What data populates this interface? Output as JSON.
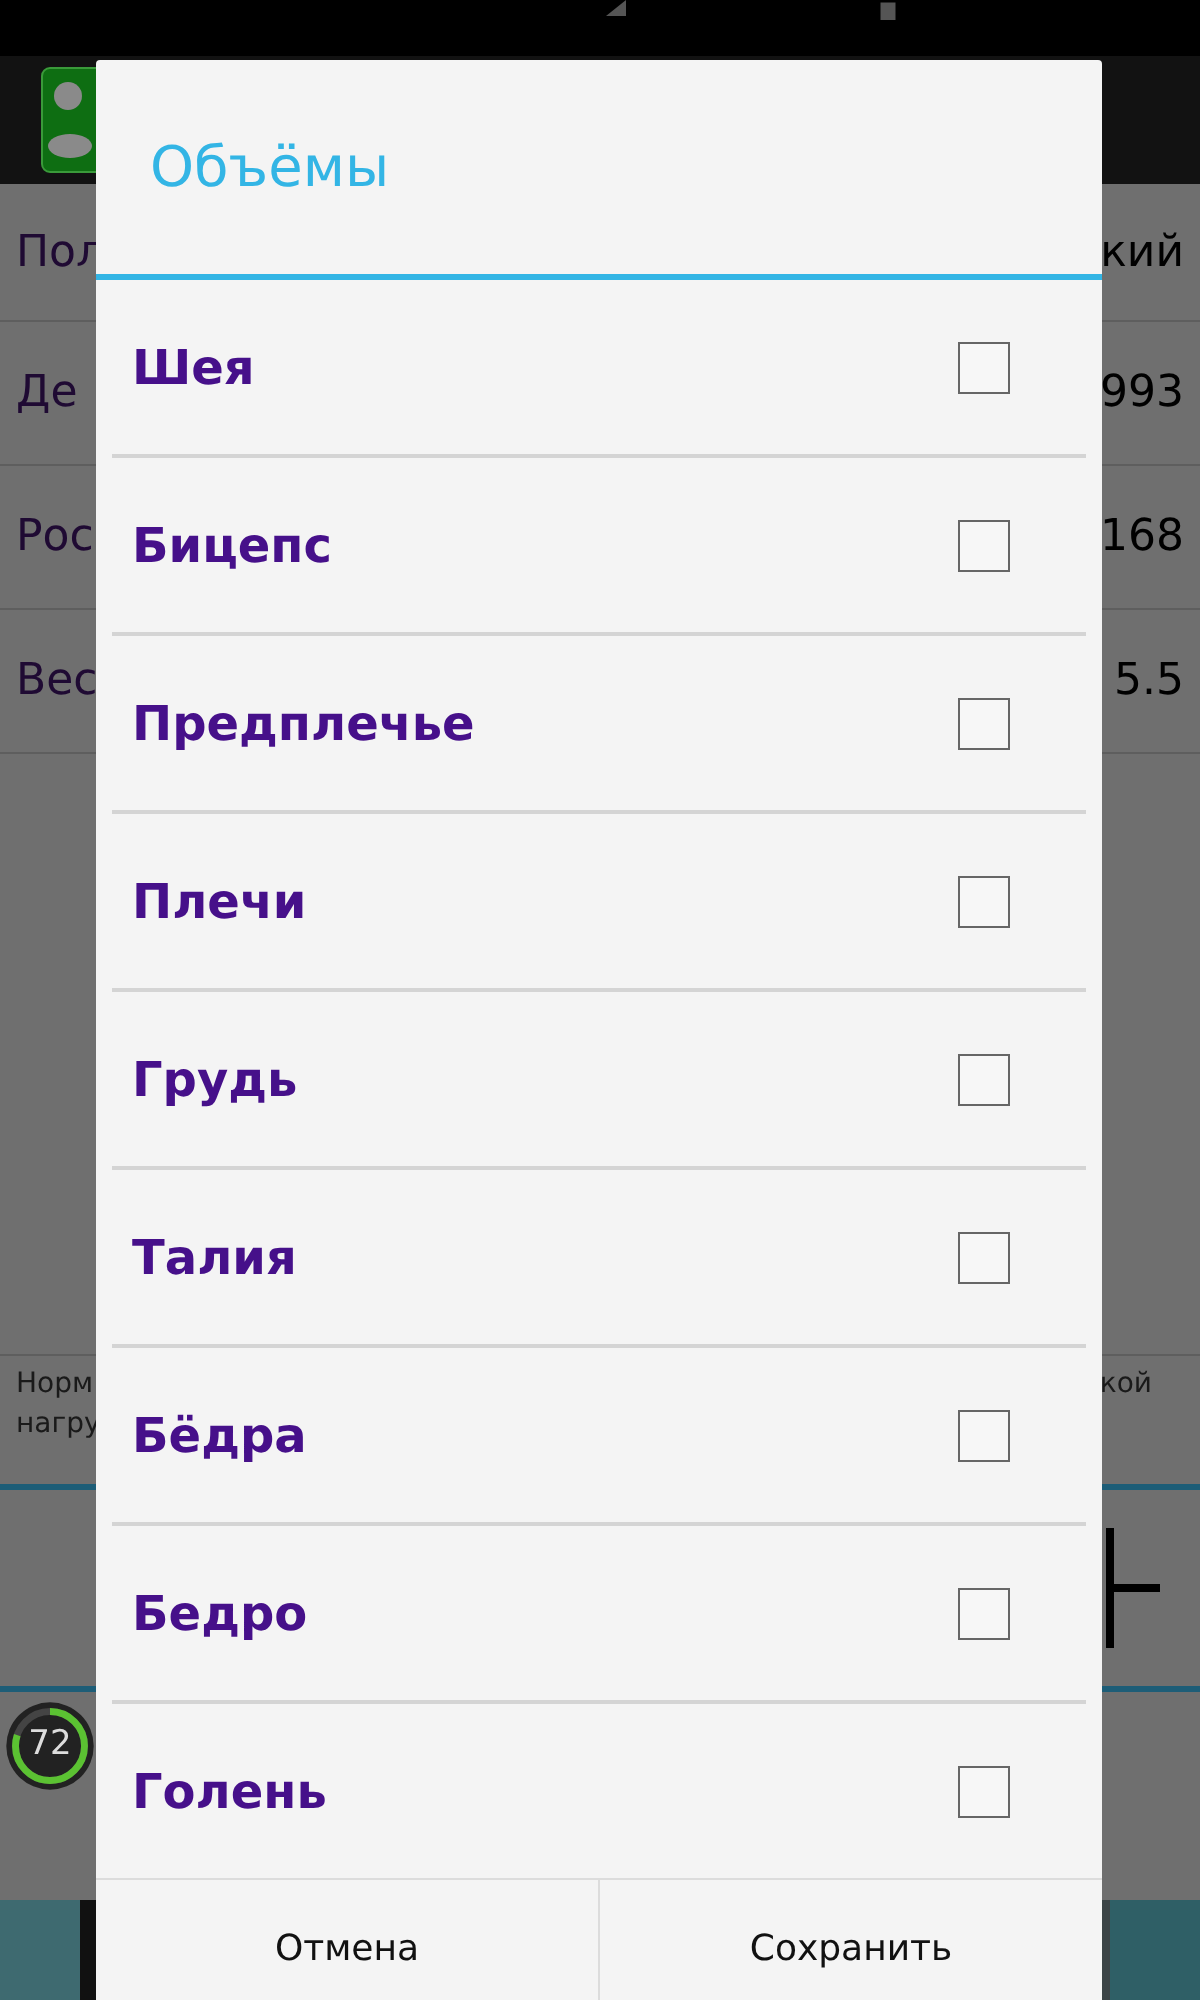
{
  "background": {
    "profile_rows": [
      {
        "label": "Пол",
        "value": "кий"
      },
      {
        "label": "Де",
        "value": "993"
      },
      {
        "label": "Рос",
        "value": "168"
      },
      {
        "label": "Вес",
        "value": "5.5"
      }
    ],
    "note": {
      "left_lines": [
        "Норм",
        "нагру"
      ],
      "right_text": "кой"
    },
    "gauge": {
      "value": "72",
      "level": 0.8
    }
  },
  "dialog": {
    "title": "Объёмы",
    "items": [
      {
        "label": "Шея",
        "checked": false
      },
      {
        "label": "Бицепс",
        "checked": false
      },
      {
        "label": "Предплечье",
        "checked": false
      },
      {
        "label": "Плечи",
        "checked": false
      },
      {
        "label": "Грудь",
        "checked": false
      },
      {
        "label": "Талия",
        "checked": false
      },
      {
        "label": "Бёдра",
        "checked": false
      },
      {
        "label": "Бедро",
        "checked": false
      },
      {
        "label": "Голень",
        "checked": false
      }
    ],
    "buttons": [
      "Отмена",
      "Сохранить"
    ]
  }
}
